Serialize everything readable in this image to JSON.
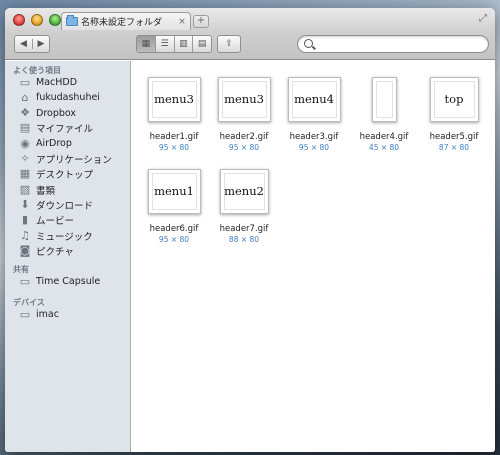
{
  "window": {
    "tab_title": "名称未設定フォルダ",
    "tab_close": "×",
    "new_tab": "+",
    "fullscreen": "⤢"
  },
  "toolbar": {
    "back": "◀",
    "forward": "▶",
    "view_icon": "▦",
    "view_list": "☰",
    "view_column": "▥",
    "view_coverflow": "▤",
    "share": "⇪",
    "search_placeholder": ""
  },
  "sidebar": {
    "favorites_title": "よく使う項目",
    "favorites": [
      {
        "label": "MacHDD",
        "icon": "harddrive-icon",
        "glyph": "▭"
      },
      {
        "label": "fukudashuhei",
        "icon": "home-icon",
        "glyph": "⌂"
      },
      {
        "label": "Dropbox",
        "icon": "dropbox-icon",
        "glyph": "❖"
      },
      {
        "label": "マイファイル",
        "icon": "all-files-icon",
        "glyph": "▤"
      },
      {
        "label": "AirDrop",
        "icon": "airdrop-icon",
        "glyph": "◉"
      },
      {
        "label": "アプリケーション",
        "icon": "applications-icon",
        "glyph": "✧"
      },
      {
        "label": "デスクトップ",
        "icon": "desktop-icon",
        "glyph": "▦"
      },
      {
        "label": "書類",
        "icon": "documents-icon",
        "glyph": "▧"
      },
      {
        "label": "ダウンロード",
        "icon": "downloads-icon",
        "glyph": "⬇"
      },
      {
        "label": "ムービー",
        "icon": "movies-icon",
        "glyph": "▮"
      },
      {
        "label": "ミュージック",
        "icon": "music-icon",
        "glyph": "♫"
      },
      {
        "label": "ピクチャ",
        "icon": "pictures-icon",
        "glyph": "◙"
      }
    ],
    "shared_title": "共有",
    "shared": [
      {
        "label": "Time Capsule",
        "icon": "time-capsule-icon",
        "glyph": "▭"
      }
    ],
    "devices_title": "デバイス",
    "devices": [
      {
        "label": "imac",
        "icon": "imac-icon",
        "glyph": "▭"
      }
    ]
  },
  "files": [
    {
      "name": "header1.gif",
      "size": "95 × 80",
      "text": "menu3",
      "w": 95,
      "h": 80
    },
    {
      "name": "header2.gif",
      "size": "95 × 80",
      "text": "menu3",
      "w": 95,
      "h": 80
    },
    {
      "name": "header3.gif",
      "size": "95 × 80",
      "text": "menu4",
      "w": 95,
      "h": 80
    },
    {
      "name": "header4.gif",
      "size": "45 × 80",
      "text": "",
      "w": 45,
      "h": 80
    },
    {
      "name": "header5.gif",
      "size": "87 × 80",
      "text": "top",
      "w": 87,
      "h": 80
    },
    {
      "name": "header6.gif",
      "size": "95 × 80",
      "text": "menu1",
      "w": 95,
      "h": 80
    },
    {
      "name": "header7.gif",
      "size": "88 × 80",
      "text": "menu2",
      "w": 88,
      "h": 80
    }
  ]
}
